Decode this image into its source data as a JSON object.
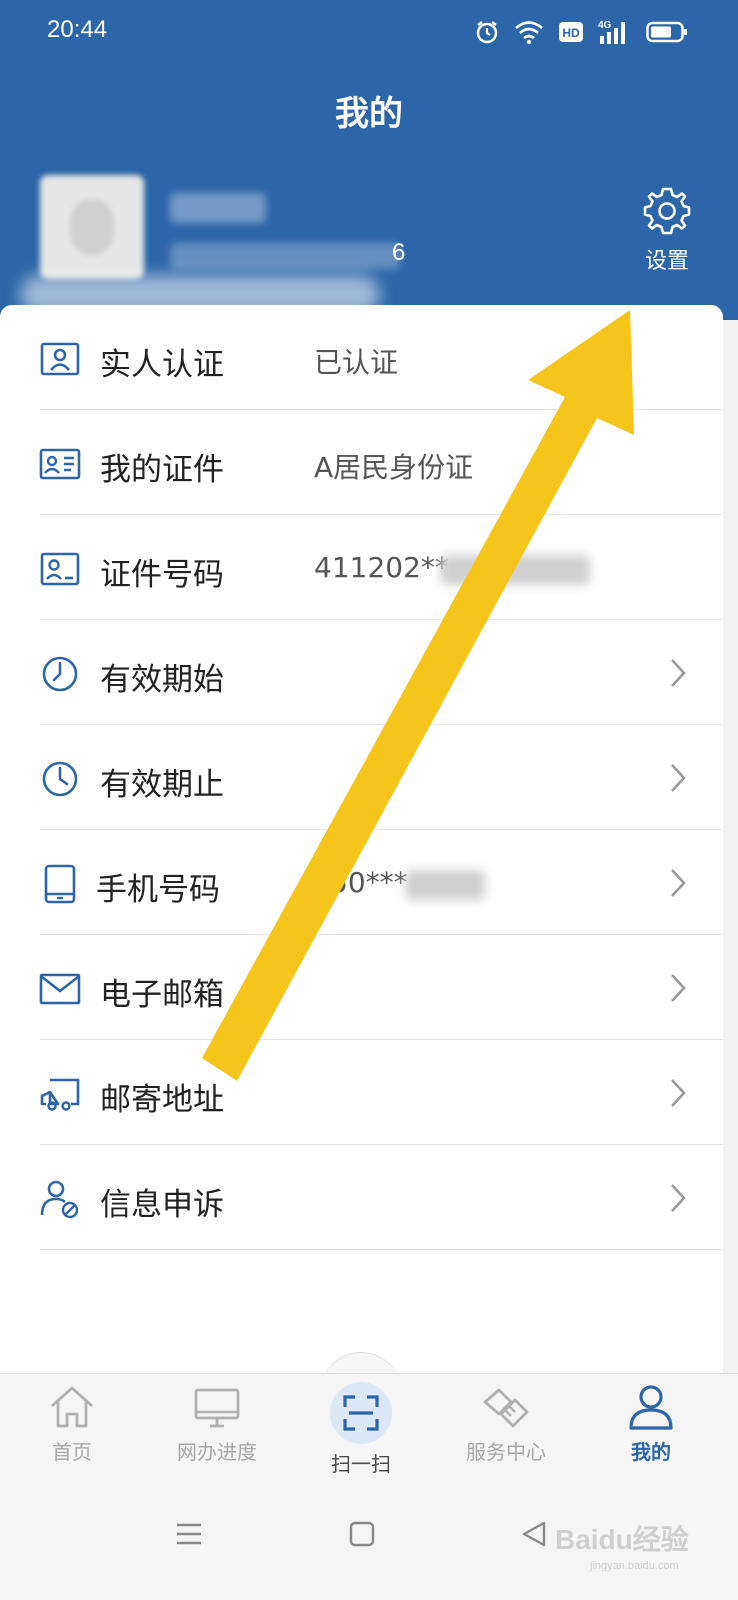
{
  "status_bar": {
    "time": "20:44",
    "icons": [
      "alarm-icon",
      "wifi-icon",
      "hd-icon",
      "4g-signal-icon",
      "battery-icon"
    ],
    "network_label": "4G",
    "hd_label": "HD"
  },
  "header": {
    "title": "我的",
    "user_id_tail": "6",
    "settings_label": "设置",
    "settings_icon": "gear-icon"
  },
  "rows": [
    {
      "label": "实人认证",
      "value": "已认证",
      "icon": "person-card-icon"
    },
    {
      "label": "我的证件",
      "value": "A居民身份证",
      "icon": "id-card-icon"
    },
    {
      "label": "证件号码",
      "value": "411202**",
      "icon": "id-number-icon"
    },
    {
      "label": "有效期始",
      "value": "",
      "icon": "clock-icon"
    },
    {
      "label": "有效期止",
      "value": "",
      "icon": "clock-icon"
    },
    {
      "label": "手机号码",
      "value": "50***",
      "icon": "phone-icon"
    },
    {
      "label": "电子邮箱",
      "value": "",
      "icon": "mail-icon"
    },
    {
      "label": "邮寄地址",
      "value": "",
      "icon": "truck-icon"
    },
    {
      "label": "信息申诉",
      "value": "",
      "icon": "user-appeal-icon"
    }
  ],
  "bottom_nav": {
    "items": [
      {
        "label": "首页",
        "icon": "home-icon"
      },
      {
        "label": "网办进度",
        "icon": "monitor-icon"
      },
      {
        "label": "扫一扫",
        "icon": "scan-icon"
      },
      {
        "label": "服务中心",
        "icon": "handshake-icon"
      },
      {
        "label": "我的",
        "icon": "user-icon"
      }
    ],
    "active_index": 4
  },
  "watermark": {
    "text": "Baidu经验",
    "url": "jingyan.baidu.com"
  },
  "colors": {
    "brand_blue": "#2c65a8",
    "arrow_yellow": "#f6c51b",
    "inactive_gray": "#a8a8a8"
  }
}
